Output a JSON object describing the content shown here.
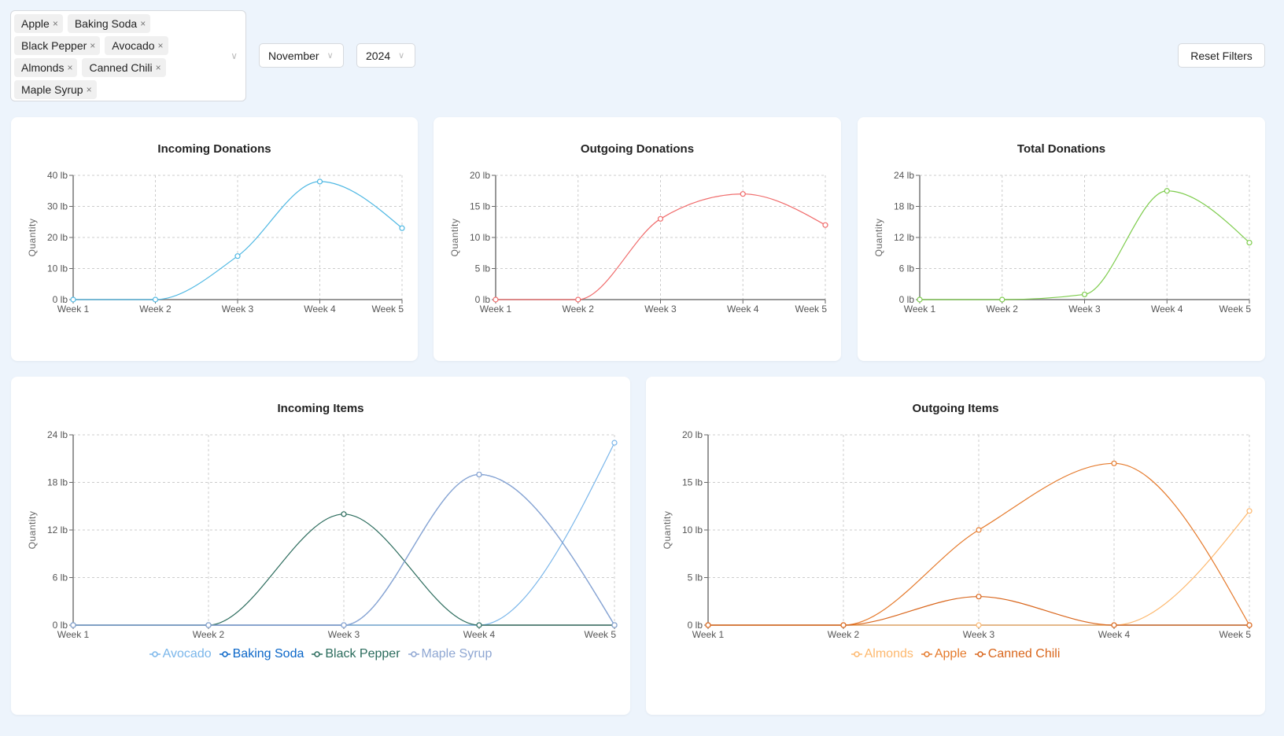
{
  "filters": {
    "items": [
      "Apple",
      "Baking Soda",
      "Black Pepper",
      "Avocado",
      "Almonds",
      "Canned Chili",
      "Maple Syrup"
    ],
    "remove_glyph": "×",
    "month": "November",
    "year": "2024",
    "chevron": "∨",
    "reset_label": "Reset Filters"
  },
  "chart_data": [
    {
      "id": "incoming-donations",
      "type": "line",
      "title": "Incoming Donations",
      "ylabel": "Quantity",
      "categories": [
        "Week 1",
        "Week 2",
        "Week 3",
        "Week 4",
        "Week 5"
      ],
      "yticks": [
        "0 lb",
        "10 lb",
        "20 lb",
        "30 lb",
        "40 lb"
      ],
      "ylim": [
        0,
        40
      ],
      "series": [
        {
          "name": "Incoming",
          "color": "#4fb8e3",
          "values": [
            0,
            0,
            14,
            38,
            23
          ]
        }
      ],
      "legend": false
    },
    {
      "id": "outgoing-donations",
      "type": "line",
      "title": "Outgoing Donations",
      "ylabel": "Quantity",
      "categories": [
        "Week 1",
        "Week 2",
        "Week 3",
        "Week 4",
        "Week 5"
      ],
      "yticks": [
        "0 lb",
        "5 lb",
        "10 lb",
        "15 lb",
        "20 lb"
      ],
      "ylim": [
        0,
        20
      ],
      "series": [
        {
          "name": "Outgoing",
          "color": "#f06b6b",
          "values": [
            0,
            0,
            13,
            17,
            12
          ]
        }
      ],
      "legend": false
    },
    {
      "id": "total-donations",
      "type": "line",
      "title": "Total Donations",
      "ylabel": "Quantity",
      "categories": [
        "Week 1",
        "Week 2",
        "Week 3",
        "Week 4",
        "Week 5"
      ],
      "yticks": [
        "0 lb",
        "6 lb",
        "12 lb",
        "18 lb",
        "24 lb"
      ],
      "ylim": [
        0,
        24
      ],
      "series": [
        {
          "name": "Total",
          "color": "#7dcc4c",
          "values": [
            0,
            0,
            1,
            21,
            11
          ]
        }
      ],
      "legend": false
    },
    {
      "id": "incoming-items",
      "type": "line",
      "title": "Incoming Items",
      "ylabel": "Quantity",
      "categories": [
        "Week 1",
        "Week 2",
        "Week 3",
        "Week 4",
        "Week 5"
      ],
      "yticks": [
        "0 lb",
        "6 lb",
        "12 lb",
        "18 lb",
        "24 lb"
      ],
      "ylim": [
        0,
        24
      ],
      "series": [
        {
          "name": "Avocado",
          "color": "#7ab6ea",
          "values": [
            0,
            0,
            0,
            0,
            23
          ]
        },
        {
          "name": "Baking Soda",
          "color": "#0a66c8",
          "values": [
            0,
            0,
            0,
            19,
            0
          ]
        },
        {
          "name": "Black Pepper",
          "color": "#2a6b5c",
          "values": [
            0,
            0,
            14,
            0,
            0
          ]
        },
        {
          "name": "Maple Syrup",
          "color": "#8ea6d2",
          "values": [
            0,
            0,
            0,
            19,
            0
          ]
        }
      ],
      "legend": true
    },
    {
      "id": "outgoing-items",
      "type": "line",
      "title": "Outgoing Items",
      "ylabel": "Quantity",
      "categories": [
        "Week 1",
        "Week 2",
        "Week 3",
        "Week 4",
        "Week 5"
      ],
      "yticks": [
        "0 lb",
        "5 lb",
        "10 lb",
        "15 lb",
        "20 lb"
      ],
      "ylim": [
        0,
        20
      ],
      "series": [
        {
          "name": "Almonds",
          "color": "#fdb86e",
          "values": [
            0,
            0,
            0,
            0,
            12
          ]
        },
        {
          "name": "Apple",
          "color": "#e57a2c",
          "values": [
            0,
            0,
            10,
            17,
            0
          ]
        },
        {
          "name": "Canned Chili",
          "color": "#d9661c",
          "values": [
            0,
            0,
            3,
            0,
            0
          ]
        }
      ],
      "legend": true
    }
  ]
}
